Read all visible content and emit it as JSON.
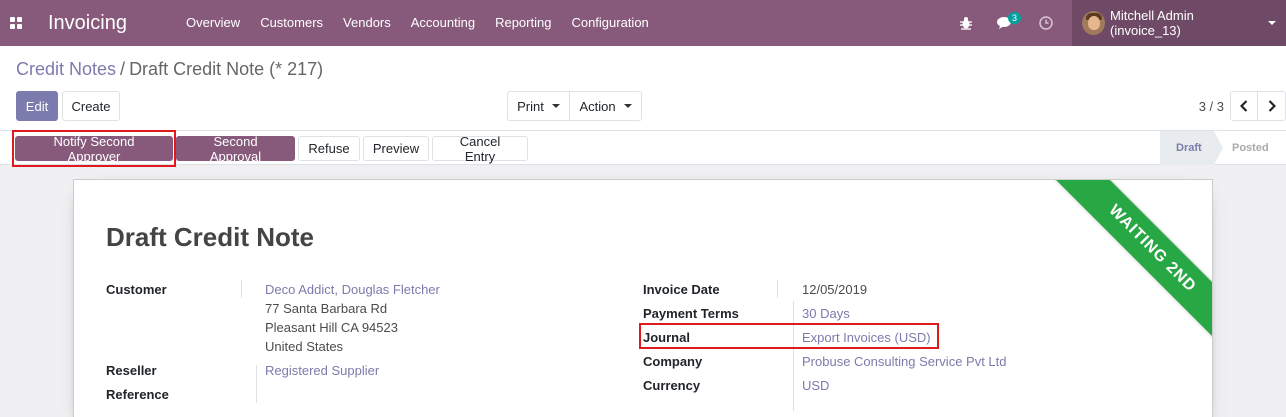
{
  "navbar": {
    "app_title": "Invoicing",
    "menu": [
      "Overview",
      "Customers",
      "Vendors",
      "Accounting",
      "Reporting",
      "Configuration"
    ],
    "chat_count": "3",
    "user_name": "Mitchell Admin (invoice_13)"
  },
  "breadcrumb": {
    "parent": "Credit Notes",
    "separator": "/",
    "current": "Draft Credit Note (* 217)"
  },
  "buttons": {
    "edit": "Edit",
    "create": "Create",
    "print": "Print",
    "action": "Action"
  },
  "pager": {
    "value": "3 / 3"
  },
  "statusbar": {
    "buttons": [
      "Notify Second Approver",
      "Second Approval",
      "Refuse",
      "Preview",
      "Cancel Entry"
    ],
    "stages": [
      "Draft",
      "Posted"
    ]
  },
  "sheet": {
    "ribbon": "WAITING 2ND",
    "title": "Draft Credit Note",
    "left_fields": {
      "customer_label": "Customer",
      "customer_name": "Deco Addict, Douglas Fletcher",
      "address_line1": "77 Santa Barbara Rd",
      "address_line2": "Pleasant Hill CA 94523",
      "address_line3": "United States",
      "reseller_label": "Reseller",
      "reseller_value": "Registered Supplier",
      "reference_label": "Reference"
    },
    "right_fields": {
      "invoice_date_label": "Invoice Date",
      "invoice_date_value": "12/05/2019",
      "payment_terms_label": "Payment Terms",
      "payment_terms_value": "30 Days",
      "journal_label": "Journal",
      "journal_value": "Export Invoices (USD)",
      "company_label": "Company",
      "company_value": "Probuse Consulting Service Pvt Ltd",
      "currency_label": "Currency",
      "currency_value": "USD"
    }
  },
  "colors": {
    "navbar": "#875a7b",
    "primary": "#7c7bad",
    "ribbon": "#28a745",
    "highlight": "#e0191c"
  }
}
